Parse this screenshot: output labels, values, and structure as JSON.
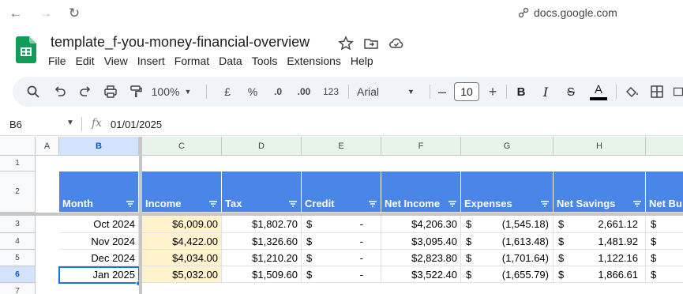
{
  "browser": {
    "url": "docs.google.com"
  },
  "document": {
    "title": "template_f-you-money-financial-overview"
  },
  "menu": [
    "File",
    "Edit",
    "View",
    "Insert",
    "Format",
    "Data",
    "Tools",
    "Extensions",
    "Help"
  ],
  "toolbar": {
    "zoom": "100%",
    "currency": "£",
    "percent": "%",
    "dec_decrease": ".0",
    "dec_increase": ".00",
    "number_format": "123",
    "font": "Arial",
    "font_size": "10"
  },
  "formula_bar": {
    "cell_ref": "B6",
    "fx": "fx",
    "content": "01/01/2025"
  },
  "columns": [
    "A",
    "B",
    "C",
    "D",
    "E",
    "F",
    "G",
    "H"
  ],
  "rows": [
    "1",
    "2",
    "3",
    "4",
    "5",
    "6",
    "7"
  ],
  "table": {
    "headers": [
      "Month",
      "Income",
      "Tax",
      "Credit",
      "Net Income",
      "Expenses",
      "Net Savings",
      "Net Bu"
    ],
    "data": [
      {
        "month": "Oct 2024",
        "income": "$6,009.00",
        "tax": "$1,802.70",
        "credit_cur": "$",
        "credit": "-",
        "net_income": "$4,206.30",
        "exp_cur": "$",
        "expenses": "(1,545.18)",
        "sav_cur": "$",
        "savings": "2,661.12",
        "nb_cur": "$"
      },
      {
        "month": "Nov 2024",
        "income": "$4,422.00",
        "tax": "$1,326.60",
        "credit_cur": "$",
        "credit": "-",
        "net_income": "$3,095.40",
        "exp_cur": "$",
        "expenses": "(1,613.48)",
        "sav_cur": "$",
        "savings": "1,481.92",
        "nb_cur": "$"
      },
      {
        "month": "Dec 2024",
        "income": "$4,034.00",
        "tax": "$1,210.20",
        "credit_cur": "$",
        "credit": "-",
        "net_income": "$2,823.80",
        "exp_cur": "$",
        "expenses": "(1,701.64)",
        "sav_cur": "$",
        "savings": "1,122.16",
        "nb_cur": "$"
      },
      {
        "month": "Jan 2025",
        "income": "$5,032.00",
        "tax": "$1,509.60",
        "credit_cur": "$",
        "credit": "-",
        "net_income": "$3,522.40",
        "exp_cur": "$",
        "expenses": "(1,655.79)",
        "sav_cur": "$",
        "savings": "1,866.61",
        "nb_cur": "$"
      }
    ]
  },
  "colors": {
    "header_blue": "#4a86e8",
    "income_fill": "#fff2cc",
    "selection": "#1a73e8"
  }
}
